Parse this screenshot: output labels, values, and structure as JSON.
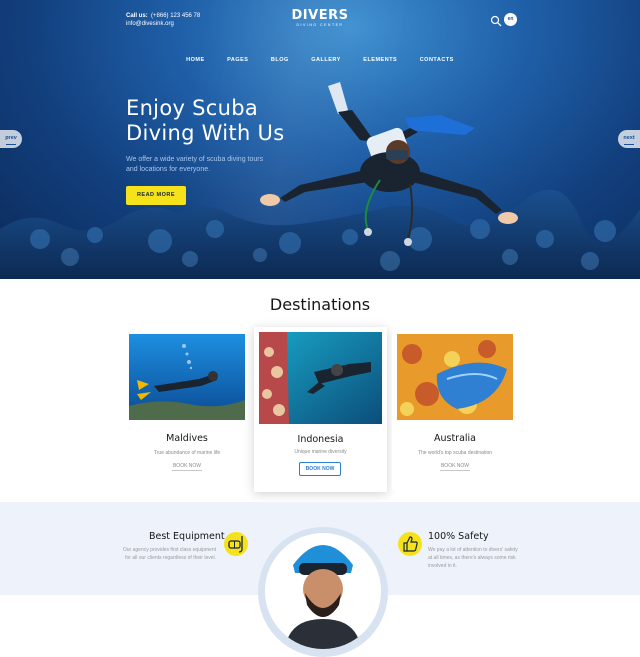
{
  "header": {
    "call_label": "Call us:",
    "phone": "(+866) 123 456 78",
    "email": "info@divesink.org",
    "logo_main": "DIVERS",
    "logo_sub": "DIVING CENTER",
    "lang": "en",
    "search_icon": "search-icon"
  },
  "nav": {
    "items": [
      "HOME",
      "PAGES",
      "BLOG",
      "GALLERY",
      "ELEMENTS",
      "CONTACTS"
    ]
  },
  "hero": {
    "title_line1": "Enjoy Scuba",
    "title_line2": "Diving With Us",
    "text": "We offer a wide variety of scuba diving tours and locations for everyone.",
    "button": "READ MORE",
    "prev": "prev",
    "next": "next"
  },
  "destinations": {
    "title": "Destinations",
    "cards": [
      {
        "name": "Maldives",
        "desc": "True abundance of marine life",
        "button": "BOOK NOW"
      },
      {
        "name": "Indonesia",
        "desc": "Unique marine diversity",
        "button": "BOOK NOW"
      },
      {
        "name": "Australia",
        "desc": "The world's top scuba destination",
        "button": "BOOK NOW"
      }
    ]
  },
  "features": {
    "left": {
      "title": "Best Equipment",
      "text": "Our agency provides first class equipment for all our clients regardless of their level.",
      "icon": "snorkel-mask-icon"
    },
    "right": {
      "title": "100% Safety",
      "text": "We pay a lot of attention to divers' safety at all times, as there's always some risk involved in it.",
      "icon": "thumbs-up-icon"
    }
  },
  "colors": {
    "accent_yellow": "#f5e21a",
    "accent_blue": "#2d7fd0",
    "hero_blue": "#123f7d"
  }
}
